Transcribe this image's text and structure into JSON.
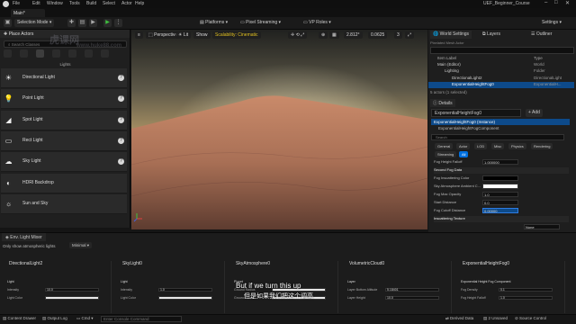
{
  "app": {
    "window_title": "UEF_Beginner_Course",
    "level_tab": "Main*"
  },
  "menu": [
    "File",
    "Edit",
    "Window",
    "Tools",
    "Build",
    "Select",
    "Actor",
    "Help"
  ],
  "toolbar": {
    "selection_mode": "Selection Mode",
    "platforms": "Platforms",
    "pixel_streaming": "Pixel Streaming",
    "vp_roles": "VP Roles",
    "settings": "Settings"
  },
  "place_actors": {
    "tab": "Place Actors",
    "search_placeholder": "Search Classes",
    "section": "Lights",
    "items": [
      {
        "label": "Directional Light",
        "icon": "sun-icon",
        "help": "?"
      },
      {
        "label": "Point Light",
        "icon": "lightbulb-icon",
        "help": "?"
      },
      {
        "label": "Spot Light",
        "icon": "spotlight-icon",
        "help": "?"
      },
      {
        "label": "Rect Light",
        "icon": "rect-light-icon",
        "help": "?"
      },
      {
        "label": "Sky Light",
        "icon": "sky-light-icon",
        "help": "?"
      },
      {
        "label": "HDRI Backdrop",
        "icon": "hdri-icon",
        "help": ""
      },
      {
        "label": "Sun and Sky",
        "icon": "sun-sky-icon",
        "help": ""
      }
    ]
  },
  "viewport": {
    "perspective": "Perspective",
    "lit": "Lit",
    "show": "Show",
    "scalability": "Scalability: Cinematic",
    "angle": "2.812°",
    "scale": "0.0625",
    "camera_speed": "3"
  },
  "world_outliner": {
    "tabs": [
      "World Settings",
      "Layers",
      "Outliner"
    ],
    "header_label": "Item Label",
    "header_type": "Type",
    "filter_hint": "Pixelated Mesh Actor",
    "rows": [
      {
        "label": "Main (Editor)",
        "type": "World"
      },
      {
        "label": "Lighting",
        "type": "Folder"
      },
      {
        "label": "DirectionalLight2",
        "type": "DirectionalLight"
      },
      {
        "label": "ExponentialHeightFog0",
        "type": "ExponentialH..."
      }
    ],
    "status": "5 actors (1 selected)"
  },
  "details": {
    "tab": "Details",
    "actor_name": "ExponentialHeightFog0",
    "add_button": "+ Add",
    "instance": "ExponentialHeightFog0 (Instance)",
    "component": "ExponentialHeightFogComponent",
    "search_placeholder": "Search",
    "filters_row1": [
      "General",
      "Actor",
      "LOD",
      "Misc",
      "Physics",
      "Rendering"
    ],
    "filters_row2": [
      "Streaming",
      "All"
    ],
    "properties": [
      {
        "label": "Fog Height Falloff",
        "value": "1.000000",
        "kind": "num"
      },
      {
        "label": "Second Fog Data",
        "value": "",
        "kind": "header"
      },
      {
        "label": "Fog Inscattering Color",
        "value": "",
        "kind": "swatch-black"
      },
      {
        "label": "Sky Atmosphere Ambient C...",
        "value": "",
        "kind": "swatch-white"
      },
      {
        "label": "Fog Max Opacity",
        "value": "1.0",
        "kind": "num"
      },
      {
        "label": "Start Distance",
        "value": "0.0",
        "kind": "num"
      },
      {
        "label": "Fog Cutoff Distance",
        "value": "0.00000",
        "kind": "num-active"
      },
      {
        "label": "Inscattering Texture",
        "value": "",
        "kind": "header"
      },
      {
        "label": "",
        "value": "None",
        "kind": "dropdown"
      }
    ]
  },
  "mixer": {
    "tab": "Env. Light Mixer",
    "option": "Only show atmospheric lights",
    "mode": "Minimal",
    "columns": [
      {
        "title": "DirectionalLight2",
        "section": "Light",
        "fields": [
          {
            "label": "Intensity",
            "value": "10.0"
          },
          {
            "label": "Light Color",
            "value": ""
          }
        ]
      },
      {
        "title": "SkyLight0",
        "section": "Light",
        "fields": [
          {
            "label": "Intensity",
            "value": "1.0"
          },
          {
            "label": "Light Color",
            "value": ""
          }
        ]
      },
      {
        "title": "SkyAtmosphere0",
        "section": "Planet",
        "fields": [
          {
            "label": "Ground Radius",
            "value": ""
          },
          {
            "label": "Ground Albedo",
            "value": ""
          }
        ]
      },
      {
        "title": "VolumetricCloud0",
        "section": "Layer",
        "fields": [
          {
            "label": "Layer Bottom Altitude",
            "value": "5.18401"
          },
          {
            "label": "Layer Height",
            "value": "10.0"
          }
        ]
      },
      {
        "title": "ExponentialHeightFog0",
        "section": "Exponential Height Fog Component",
        "fields": [
          {
            "label": "Fog Density",
            "value": "0.1"
          },
          {
            "label": "Fog Height Falloff",
            "value": "1.0"
          }
        ]
      }
    ]
  },
  "statusbar": {
    "content_drawer": "Content Drawer",
    "output_log": "Output Log",
    "cmd": "Cmd",
    "console_placeholder": "Enter Console Command",
    "derived_data": "Derived Data",
    "unsaved": "2 Unsaved",
    "source_control": "Source Control"
  },
  "subtitle": {
    "en": "But if we turn this up",
    "zh": "但是如果我们把这个调高"
  },
  "watermark": {
    "cn": "虎课网",
    "url": "www.huke88.com"
  }
}
